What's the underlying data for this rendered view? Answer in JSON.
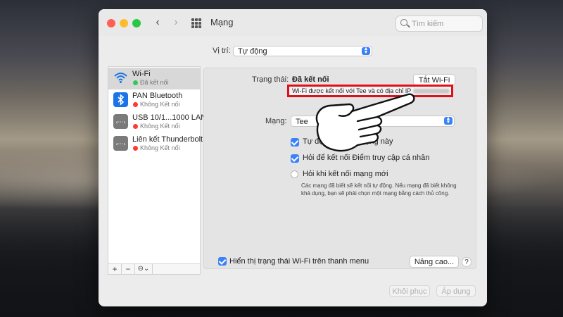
{
  "window": {
    "title": "Mạng"
  },
  "search": {
    "placeholder": "Tìm kiếm"
  },
  "location": {
    "label": "Vị trí:",
    "value": "Tự động"
  },
  "services": [
    {
      "name": "Wi-Fi",
      "status": "Đã kết nối",
      "status_color": "#34c759",
      "icon": "wifi-icon"
    },
    {
      "name": "PAN Bluetooth",
      "status": "Không Kết nối",
      "status_color": "#ff3b30",
      "icon": "bluetooth-icon"
    },
    {
      "name": "USB 10/1...1000 LAN",
      "status": "Không Kết nối",
      "status_color": "#ff3b30",
      "icon": "ethernet-icon"
    },
    {
      "name": "Liên kết Thunderbolt",
      "status": "Không Kết nối",
      "status_color": "#ff3b30",
      "icon": "ethernet-icon"
    }
  ],
  "sidebar_footer": {
    "add": "+",
    "remove": "−",
    "action": "⊖⌄"
  },
  "detail": {
    "status_label": "Trạng thái:",
    "status_value": "Đã kết nối",
    "wifi_off_button": "Tắt Wi-Fi",
    "status_description": "Wi-Fi được kết nối với Tee và có địa chỉ IP",
    "network_label": "Mạng:",
    "network_name": "Tee",
    "options": [
      {
        "label": "Tự động kết nối mạng này",
        "checked": true
      },
      {
        "label": "Hỏi để kết nối Điểm truy cập cá nhân",
        "checked": true
      },
      {
        "label": "Hỏi khi kết nối mạng mới",
        "checked": false
      }
    ],
    "hint": "Các mạng đã biết sẽ kết nối tự động. Nếu mạng đã biết không khả dụng, bạn sẽ phải chọn một mạng bằng cách thủ công.",
    "show_in_menubar": "Hiển thị trạng thái Wi-Fi trên thanh menu",
    "show_in_menubar_checked": true,
    "advanced_button": "Nâng cao...",
    "help_button": "?"
  },
  "footer": {
    "revert": "Khôi phục",
    "apply": "Áp dụng"
  },
  "colors": {
    "accent": "#3b82f6",
    "highlight": "#e0101a"
  }
}
